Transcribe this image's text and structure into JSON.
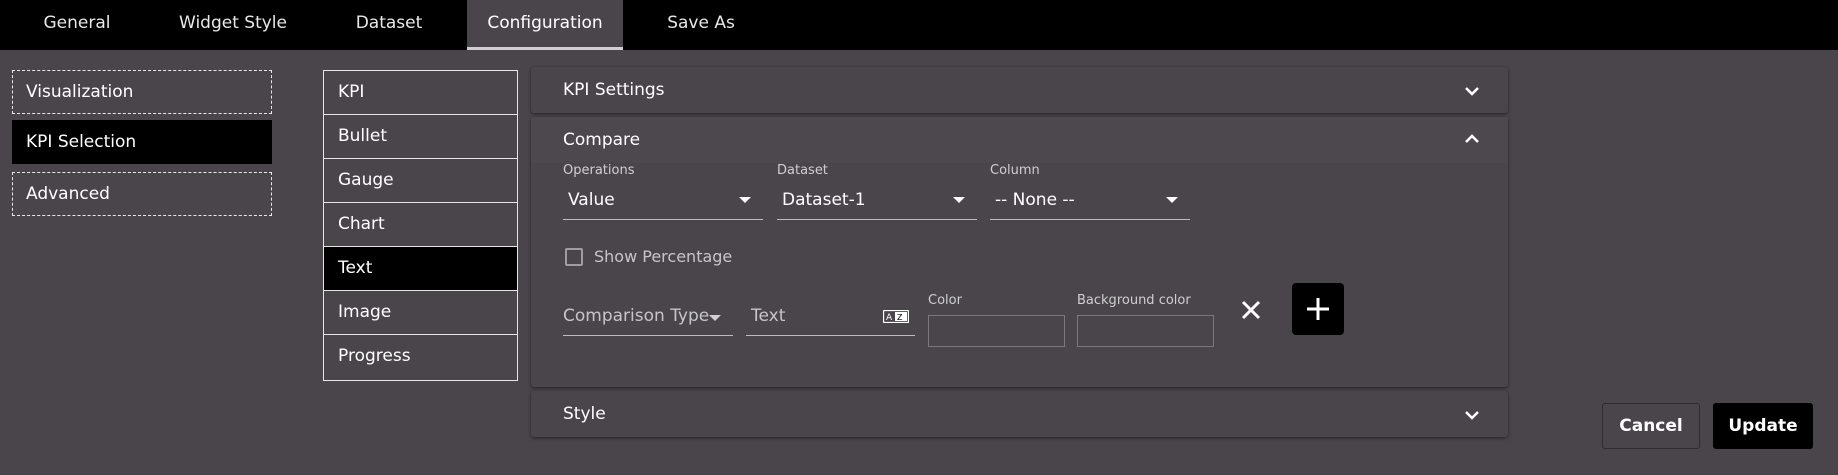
{
  "tabs": [
    {
      "label": "General"
    },
    {
      "label": "Widget Style"
    },
    {
      "label": "Dataset"
    },
    {
      "label": "Configuration",
      "active": true
    },
    {
      "label": "Save As"
    }
  ],
  "leftnav": [
    {
      "label": "Visualization"
    },
    {
      "label": "KPI Selection",
      "active": true
    },
    {
      "label": "Advanced"
    }
  ],
  "kpi_types": [
    {
      "label": "KPI"
    },
    {
      "label": "Bullet"
    },
    {
      "label": "Gauge"
    },
    {
      "label": "Chart"
    },
    {
      "label": "Text",
      "active": true
    },
    {
      "label": "Image"
    },
    {
      "label": "Progress"
    }
  ],
  "panels": {
    "kpi_settings": {
      "title": "KPI Settings",
      "expanded": false
    },
    "compare": {
      "title": "Compare",
      "expanded": true
    },
    "style": {
      "title": "Style",
      "expanded": false
    }
  },
  "compare": {
    "operations": {
      "label": "Operations",
      "value": "Value"
    },
    "dataset": {
      "label": "Dataset",
      "value": "Dataset-1"
    },
    "column": {
      "label": "Column",
      "value": "-- None --"
    },
    "show_percentage": {
      "label": "Show Percentage",
      "checked": false
    },
    "comparison_type": {
      "placeholder": "Comparison Type"
    },
    "text": {
      "placeholder": "Text"
    },
    "color": {
      "label": "Color",
      "value": ""
    },
    "background_color": {
      "label": "Background color",
      "value": ""
    }
  },
  "buttons": {
    "cancel": "Cancel",
    "update": "Update"
  },
  "icons": {
    "chevron_down": "chevron-down-icon",
    "chevron_up": "chevron-up-icon",
    "close": "close-icon",
    "plus": "plus-icon",
    "translate": "translate-icon"
  },
  "colors": {
    "background": "#4a454b",
    "topbar": "#000000",
    "active": "#000000",
    "text": "#ffffff",
    "muted": "#c6c6c6"
  }
}
